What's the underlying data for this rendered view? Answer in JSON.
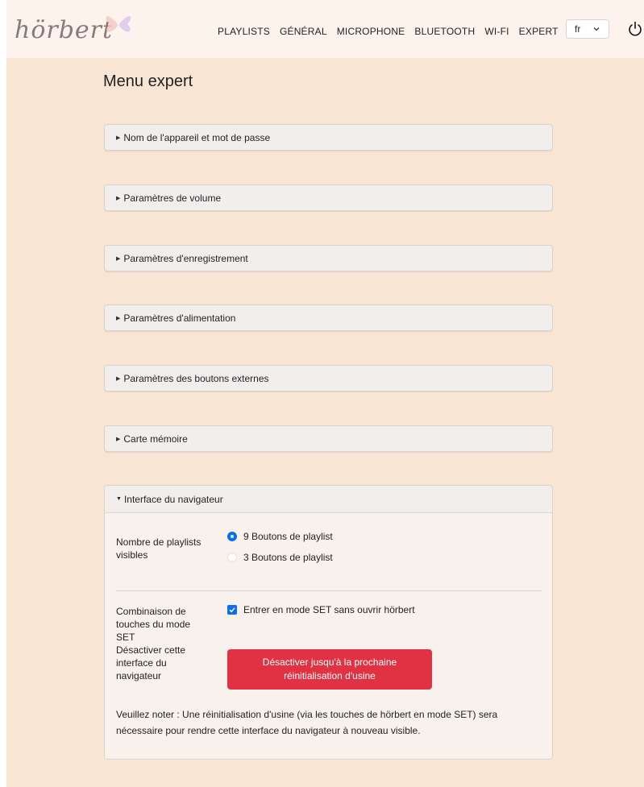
{
  "app": {
    "logo_text": "hörbert"
  },
  "nav": {
    "links": [
      "PLAYLISTS",
      "GÉNÉRAL",
      "MICROPHONE",
      "BLUETOOTH",
      "WI-FI",
      "EXPERT"
    ],
    "language_value": "fr"
  },
  "page": {
    "title": "Menu expert"
  },
  "sections": {
    "items": [
      "Nom de l'appareil et mot de passe",
      "Paramètres de volume",
      "Paramètres d'enregistrement",
      "Paramètres d'alimentation",
      "Paramètres des boutons externes",
      "Carte mémoire"
    ],
    "open_title": "Interface du navigateur"
  },
  "browser_interface": {
    "playlists_label_1": "Nombre de playlists",
    "playlists_label_2": "visibles",
    "option_9": "9 Boutons de playlist",
    "option_3": "3 Boutons de playlist",
    "selected_option": "9 Boutons de playlist",
    "set_label_1": "Combinaison de",
    "set_label_2": "touches du mode",
    "set_label_3": "SET",
    "set_checkbox_label": "Entrer en mode SET sans ouvrir hörbert",
    "set_checkbox_checked": true,
    "disable_label_1": "Désactiver cette",
    "disable_label_2": "interface du",
    "disable_label_3": "navigateur",
    "disable_button_line1": "Désactiver jusqu'à la prochaine",
    "disable_button_line2": "réinitialisation d'usine",
    "note": "Veuillez noter : Une réinitialisation d'usine (via les touches de hörbert en mode SET) sera nécessaire pour rendre cette interface du navigateur à nouveau visible."
  },
  "colors": {
    "page_bg": "#f9e5d4",
    "navbar_bg": "#fdf3ec",
    "accent_blue": "#0a6ef2",
    "danger_red": "#e03243"
  }
}
